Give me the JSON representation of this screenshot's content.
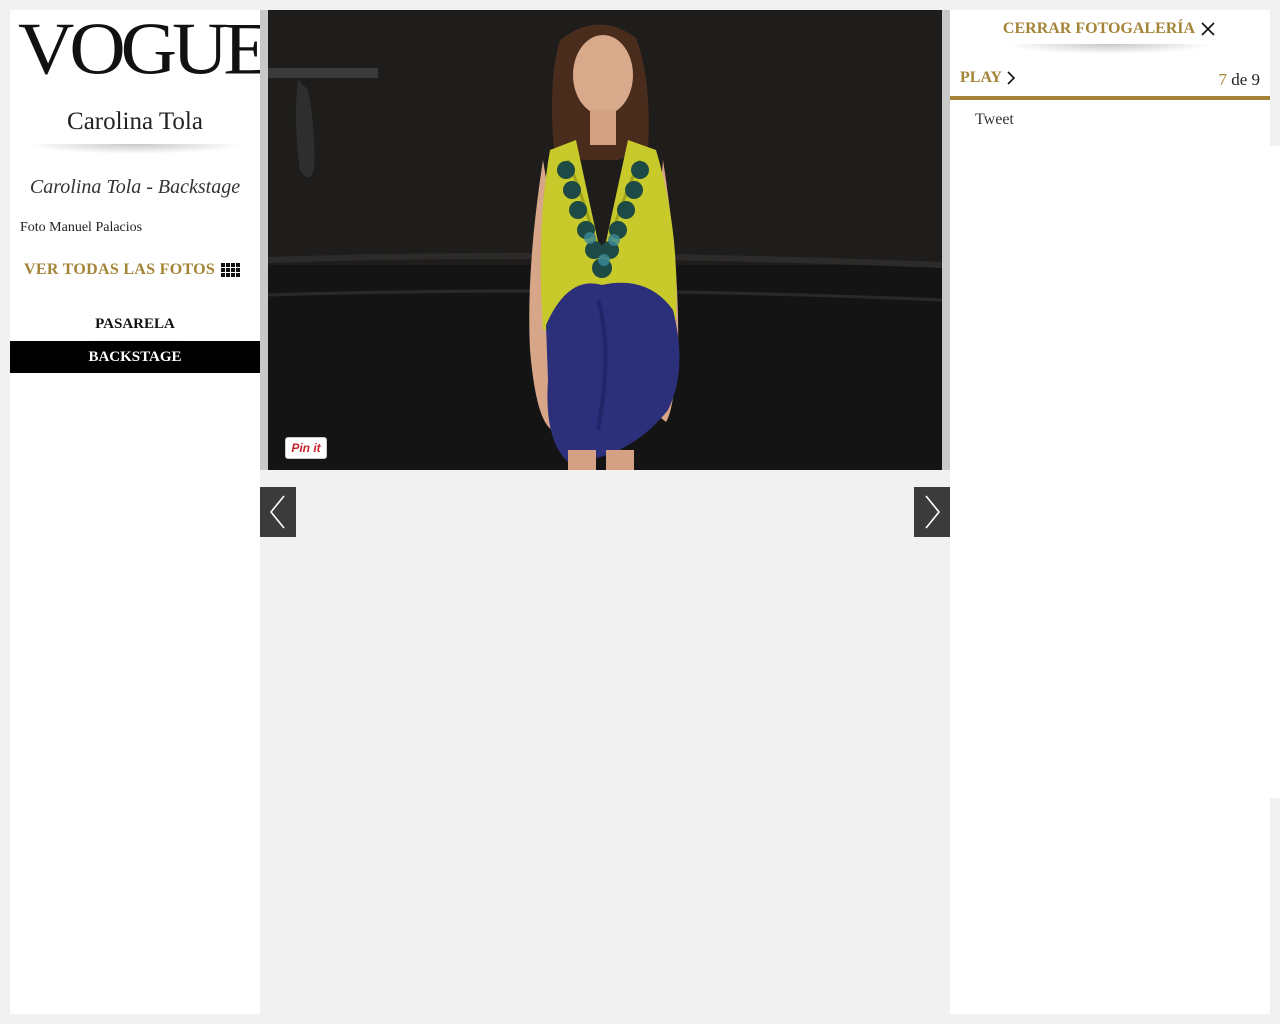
{
  "brand": {
    "logo": "VOGUE"
  },
  "sidebar": {
    "designer": "Carolina Tola",
    "gallery_title": "Carolina Tola - Backstage",
    "credit": "Foto Manuel Palacios",
    "all_photos_label": "VER TODAS LAS FOTOS",
    "all_photos_icon": "grid-icon",
    "tabs": [
      {
        "label": "PASARELA",
        "active": false
      },
      {
        "label": "BACKSTAGE",
        "active": true
      }
    ]
  },
  "photo": {
    "pin_label": "Pin it",
    "prev_icon": "chevron-left-icon",
    "next_icon": "chevron-right-icon"
  },
  "panel": {
    "close_label": "CERRAR FOTOGALERÍA",
    "close_icon": "close-icon",
    "play_label": "PLAY",
    "play_icon": "chevron-right-icon",
    "counter": {
      "current": "7",
      "separator": "de",
      "total": "9"
    },
    "tweet_label": "Tweet"
  },
  "colors": {
    "accent_gold": "#a48437",
    "tab_active_bg": "#000000",
    "arrow_bg": "#3b3b3b",
    "page_bg": "#f1f1f1"
  }
}
